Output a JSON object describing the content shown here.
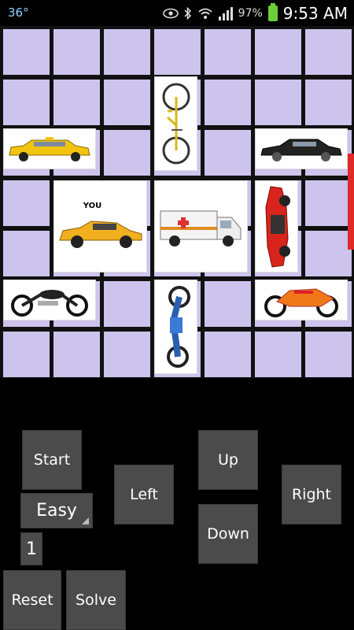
{
  "status_bar": {
    "temperature": "36°",
    "battery_percent": "97%",
    "time": "9:53 AM",
    "icons": [
      "eye-icon",
      "bluetooth-icon",
      "wifi-icon",
      "signal-icon",
      "battery-icon"
    ]
  },
  "game": {
    "board_rows": 7,
    "board_cols": 7,
    "player_label": "YOU",
    "vehicles": [
      {
        "id": "bicycle",
        "kind": "bicycle",
        "orientation": "vertical",
        "row": 1,
        "col": 3,
        "length": 2
      },
      {
        "id": "taxi",
        "kind": "taxi-limo",
        "orientation": "horizontal",
        "row": 2,
        "col": 0,
        "length": 2
      },
      {
        "id": "black-sedan",
        "kind": "sedan",
        "orientation": "horizontal",
        "row": 2,
        "col": 5,
        "length": 2
      },
      {
        "id": "player-car",
        "kind": "sports-car",
        "orientation": "horizontal",
        "row": 3,
        "col": 1,
        "length": 2,
        "rows_span": 2
      },
      {
        "id": "ambulance",
        "kind": "ambulance",
        "orientation": "horizontal",
        "row": 3,
        "col": 3,
        "length": 2,
        "rows_span": 2
      },
      {
        "id": "red-car",
        "kind": "red-sports-car",
        "orientation": "vertical",
        "row": 3,
        "col": 5,
        "length": 2
      },
      {
        "id": "cruiser-motorcycle",
        "kind": "motorcycle",
        "orientation": "horizontal",
        "row": 5,
        "col": 0,
        "length": 2
      },
      {
        "id": "blue-motorcycle",
        "kind": "motorcycle",
        "orientation": "vertical",
        "row": 5,
        "col": 3,
        "length": 2
      },
      {
        "id": "orange-motorcycle",
        "kind": "motorcycle",
        "orientation": "horizontal",
        "row": 5,
        "col": 5,
        "length": 2
      }
    ]
  },
  "controls": {
    "start_label": "Start",
    "difficulty_value": "Easy",
    "level_value": "1",
    "reset_label": "Reset",
    "solve_label": "Solve",
    "left_label": "Left",
    "up_label": "Up",
    "down_label": "Down",
    "right_label": "Right"
  },
  "colors": {
    "cell": "#ccc4ec",
    "grid_line": "#111111",
    "button": "#4b4b4b",
    "accent_red": "#e02a2a"
  }
}
